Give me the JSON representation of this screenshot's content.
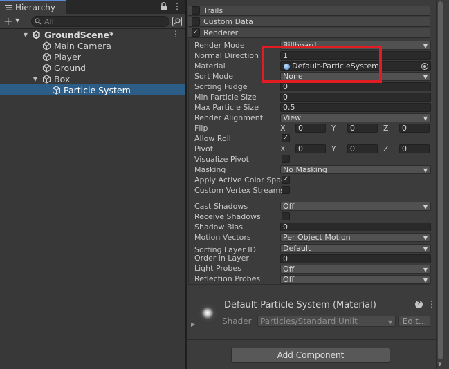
{
  "hierarchy": {
    "tab_title": "Hierarchy",
    "search": {
      "placeholder": "All"
    },
    "scene": {
      "name": "GroundScene*"
    },
    "items": [
      {
        "label": "Main Camera"
      },
      {
        "label": "Player"
      },
      {
        "label": "Ground"
      },
      {
        "label": "Box"
      },
      {
        "label": "Particle System"
      }
    ]
  },
  "inspector": {
    "modules": [
      {
        "label": "Trails",
        "enabled": false
      },
      {
        "label": "Custom Data",
        "enabled": false
      },
      {
        "label": "Renderer",
        "enabled": true
      }
    ],
    "renderer": {
      "render_mode": {
        "label": "Render Mode",
        "value": "Billboard"
      },
      "normal_direction": {
        "label": "Normal Direction",
        "value": "1"
      },
      "material": {
        "label": "Material",
        "value": "Default-ParticleSystem"
      },
      "sort_mode": {
        "label": "Sort Mode",
        "value": "None"
      },
      "sorting_fudge": {
        "label": "Sorting Fudge",
        "value": "0"
      },
      "min_particle_size": {
        "label": "Min Particle Size",
        "value": "0"
      },
      "max_particle_size": {
        "label": "Max Particle Size",
        "value": "0.5"
      },
      "render_alignment": {
        "label": "Render Alignment",
        "value": "View"
      },
      "flip": {
        "label": "Flip",
        "x": "0",
        "y": "0",
        "z": "0"
      },
      "allow_roll": {
        "label": "Allow Roll",
        "checked": true
      },
      "pivot": {
        "label": "Pivot",
        "x": "0",
        "y": "0",
        "z": "0"
      },
      "visualize_pivot": {
        "label": "Visualize Pivot",
        "checked": false
      },
      "masking": {
        "label": "Masking",
        "value": "No Masking"
      },
      "apply_active_color_space": {
        "label": "Apply Active Color Space",
        "checked": true
      },
      "custom_vertex_streams": {
        "label": "Custom Vertex Streams",
        "checked": false
      },
      "cast_shadows": {
        "label": "Cast Shadows",
        "value": "Off"
      },
      "receive_shadows": {
        "label": "Receive Shadows",
        "checked": false
      },
      "shadow_bias": {
        "label": "Shadow Bias",
        "value": "0"
      },
      "motion_vectors": {
        "label": "Motion Vectors",
        "value": "Per Object Motion"
      },
      "sorting_layer_id": {
        "label": "Sorting Layer ID",
        "value": "Default"
      },
      "order_in_layer": {
        "label": "Order in Layer",
        "value": "0"
      },
      "light_probes": {
        "label": "Light Probes",
        "value": "Off"
      },
      "reflection_probes": {
        "label": "Reflection Probes",
        "value": "Off"
      }
    },
    "axis_labels": {
      "x": "X",
      "y": "Y",
      "z": "Z"
    },
    "material_section": {
      "title": "Default-Particle System (Material)",
      "shader_label": "Shader",
      "shader_value": "Particles/Standard Unlit",
      "edit_label": "Edit..."
    },
    "add_component_label": "Add Component"
  },
  "colors": {
    "selection": "#2c5d87",
    "highlight_box": "#e31b23",
    "panel_bg": "#383838",
    "inspector_bg": "#3c3c3c"
  }
}
